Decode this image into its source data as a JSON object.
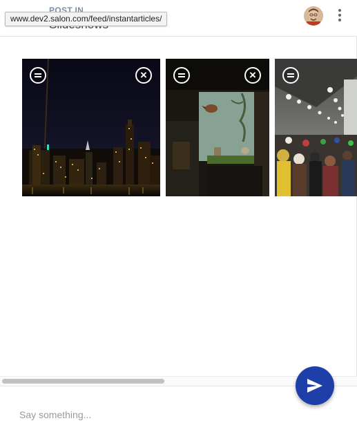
{
  "header": {
    "post_in_label": "POST IN",
    "post_title": "Slideshows",
    "url_tooltip": "www.dev2.salon.com/feed/instantarticles/"
  },
  "photos": [
    {
      "alt": "City skyline at night"
    },
    {
      "alt": "Museum diorama with bird"
    },
    {
      "alt": "Crowded convention hall"
    }
  ],
  "composer": {
    "placeholder": "Say something..."
  },
  "colors": {
    "accent": "#1f3fa8",
    "post_in": "#7a8fa3"
  },
  "icons": {
    "back": "back-arrow-icon",
    "menu": "more-vert-icon",
    "drag": "drag-handle-icon",
    "remove": "close-icon",
    "send": "send-icon"
  }
}
